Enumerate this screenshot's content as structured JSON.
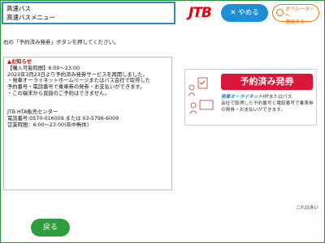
{
  "header": {
    "breadcrumb": [
      "高速バス",
      "高速バスメニュー"
    ],
    "logo_text": "JTB",
    "close_button": {
      "icon": "close-icon",
      "label": "やめる"
    },
    "operator_button": {
      "icon": "operator-icon",
      "label_line1": "オペレーターへ",
      "label_line2": "連絡する"
    }
  },
  "instruction": "右の「予約済み発券」ボタンを押してください。",
  "notice": {
    "title": "お知らせ",
    "body": "【購入可能時間】6:00〜23:00\n2023年3月23日より予約済み発券サービスを再開しました。\n・発車オーライネットホームページまたはバス会社で取得した\n予約番号・電話番号で乗車券の発券・お支払いができます。\n・この端末から直接のご予約はできません。\n\n\nJTB HTA販売センター\n電話番号:0570-016009 または 03-5796-6009\n営業時間：6:00〜23:00(年中無休)"
  },
  "banner": {
    "button_label": "予約済み発券",
    "brand": "発車オーライネット",
    "description_line1": "HPまたはバス",
    "description_rest": "会社で取得した予約番号と電話番号で乗車券の発券・お支払いができます。"
  },
  "footer_note": {
    "prefix": "これは",
    "red": "赤い"
  },
  "back_button": {
    "label": "戻る"
  },
  "colors": {
    "accent_blue": "#1e8fd6",
    "jtb_red": "#e60012",
    "banner_red": "#d9173a",
    "back_green": "#2f9c3f",
    "operator_orange": "#e8730c"
  }
}
